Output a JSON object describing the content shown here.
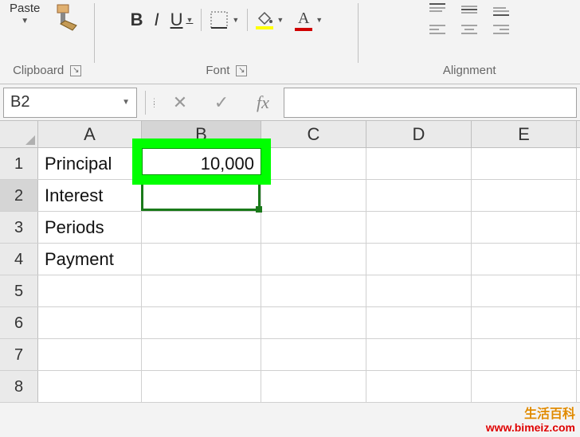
{
  "ribbon": {
    "clipboard": {
      "paste_label": "Paste",
      "group_label": "Clipboard"
    },
    "font": {
      "group_label": "Font",
      "bold": "B",
      "italic": "I",
      "underline": "U",
      "fill_color": "#ffff00",
      "font_color": "#d00000"
    },
    "alignment": {
      "group_label": "Alignment"
    }
  },
  "formula_bar": {
    "name_box": "B2",
    "fx_label": "fx",
    "formula": ""
  },
  "grid": {
    "columns": [
      "A",
      "B",
      "C",
      "D",
      "E"
    ],
    "rows": [
      "1",
      "2",
      "3",
      "4",
      "5",
      "6",
      "7",
      "8"
    ],
    "selected_cell": "B2",
    "cells": {
      "A1": "Principal",
      "B1": "10,000",
      "A2": "Interest",
      "A3": "Periods",
      "A4": "Payment"
    }
  },
  "watermark": {
    "line1": "生活百科",
    "line2": "www.bimeiz.com"
  }
}
